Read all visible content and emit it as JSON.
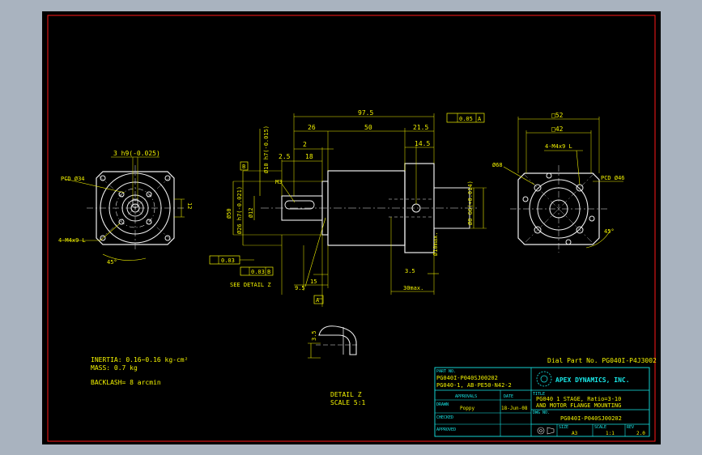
{
  "drawing": {
    "part_no_label": "Dial Part No. PG040I-P4J3002",
    "specs": {
      "inertia": "INERTIA: 0.16~0.16 kg-cm²",
      "mass": "MASS: 0.7 kg",
      "backlash": "BACKLASH= 8 arcmin"
    },
    "detail_label": "DETAIL Z",
    "detail_scale": "SCALE 5:1",
    "see_detail": "SEE DETAIL Z",
    "front_left": {
      "key_dim": "3 h9(-0.025)",
      "pcd": "PCD Ø34",
      "holes": "4-M4x9 L",
      "angle": "45°",
      "dim_12": "12"
    },
    "side": {
      "d_975": "97.5",
      "d_26": "26",
      "d_50": "50",
      "d_215": "21.5",
      "tol_box": "0.05",
      "tol_ref": "A",
      "d_25": "2.5",
      "d_18": "18",
      "d_2": "2",
      "d_145": "14.5",
      "d_10h7": "Ø10 h7(-0.015)",
      "d_50dia": "Ø50",
      "d_26h7": "Ø26 h7(-0.021)",
      "d_12": "Ø12",
      "m3": "M3",
      "d_6g6": "Ø8 G6(+0.014)",
      "d_10max": "Ø10max.",
      "d_35": "3.5",
      "d_30max": "30max.",
      "d_15": "15",
      "d_95": "9.5",
      "datum_b": "B",
      "datum_a": "A",
      "tol_003a": "0.03",
      "tol_003b": "0.03",
      "tol_ref_b": "B",
      "d_35b": "3.5"
    },
    "front_right": {
      "sq52": "□52",
      "sq42": "□42",
      "holes": "4-M4x9 L",
      "d68": "Ø68",
      "pcd": "PCD Ø46",
      "angle": "45°"
    },
    "title_block": {
      "part_no_caption": "PART NO.",
      "part_lines": [
        "PG040I-P040SJ00202",
        "PG040-1, AB-PE50-N42-2"
      ],
      "company": "APEX DYNAMICS, INC.",
      "title_caption": "TITLE",
      "title_lines": [
        "PG040 1 STAGE, Ratio=3-10",
        "AND MOTOR FLANGE MOUNTING"
      ],
      "drawn_caption": "DRAWN",
      "approval_caption": "APPROVALS",
      "date_caption": "DATE",
      "drawn_by": "Poppy",
      "date": "18-Jun-08",
      "checked_caption": "CHECKED",
      "dwg_caption": "DWG NO.",
      "dwg_no": "PG040I-P040SJ00202",
      "approved_caption": "APPROVED",
      "size_caption": "SIZE",
      "size": "A3",
      "scale_caption": "SCALE",
      "scale": "1:1",
      "rev_caption": "REV",
      "rev": "2.0"
    }
  },
  "colors": {
    "border": "#ff1818",
    "dims": "#f2f200",
    "outline": "#f0f0f0",
    "center": "#e8e8e8",
    "title": "#18e8e8"
  }
}
